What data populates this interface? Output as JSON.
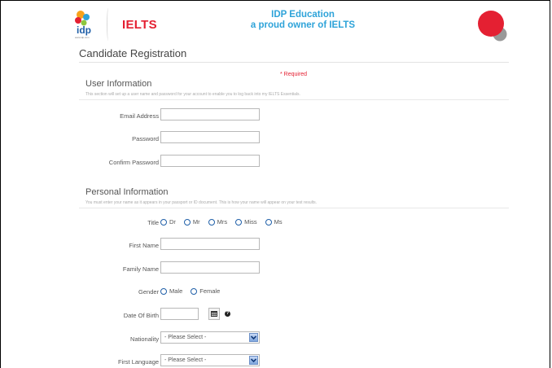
{
  "header": {
    "brand_logo_text": "idp",
    "brand_logo_subtext": "www.idp.com",
    "ielts_logo_text": "IELTS",
    "tagline_line1": "IDP Education",
    "tagline_line2": "a proud owner of IELTS",
    "colors": {
      "ielts_red": "#e42032",
      "tagline_blue": "#2ea3d9",
      "circle_red": "#e42032",
      "circle_grey": "#999999"
    }
  },
  "page": {
    "title": "Candidate Registration",
    "required_note": "* Required"
  },
  "user_info": {
    "title": "User Information",
    "description": "This section will set up a user name and password for your account to enable you to log back into my IELTS Essentials.",
    "fields": [
      {
        "label": "Email Address",
        "required": "*",
        "value": ""
      },
      {
        "label": "Password",
        "required": "*",
        "value": ""
      },
      {
        "label": "Confirm Password",
        "required": "*",
        "value": ""
      }
    ]
  },
  "personal_info": {
    "title": "Personal Information",
    "description": "You must enter your name as it appears in your passport or ID document. This is how your name will appear on your test results.",
    "title_field": {
      "label": "Title",
      "required": "*",
      "options": [
        "Dr",
        "Mr",
        "Mrs",
        "Miss",
        "Ms"
      ]
    },
    "first_name": {
      "label": "First Name",
      "required": "*",
      "value": ""
    },
    "family_name": {
      "label": "Family Name",
      "required": "*",
      "value": ""
    },
    "gender": {
      "label": "Gender",
      "required": "*",
      "options": [
        "Male",
        "Female"
      ]
    },
    "dob": {
      "label": "Date Of Birth",
      "required": "*",
      "value": "",
      "help_icon": "?"
    },
    "nationality": {
      "label": "Nationality",
      "required": "*",
      "selected": "- Please Select -"
    },
    "first_language": {
      "label": "First Language",
      "required": "*",
      "selected": "- Please Select -"
    }
  }
}
